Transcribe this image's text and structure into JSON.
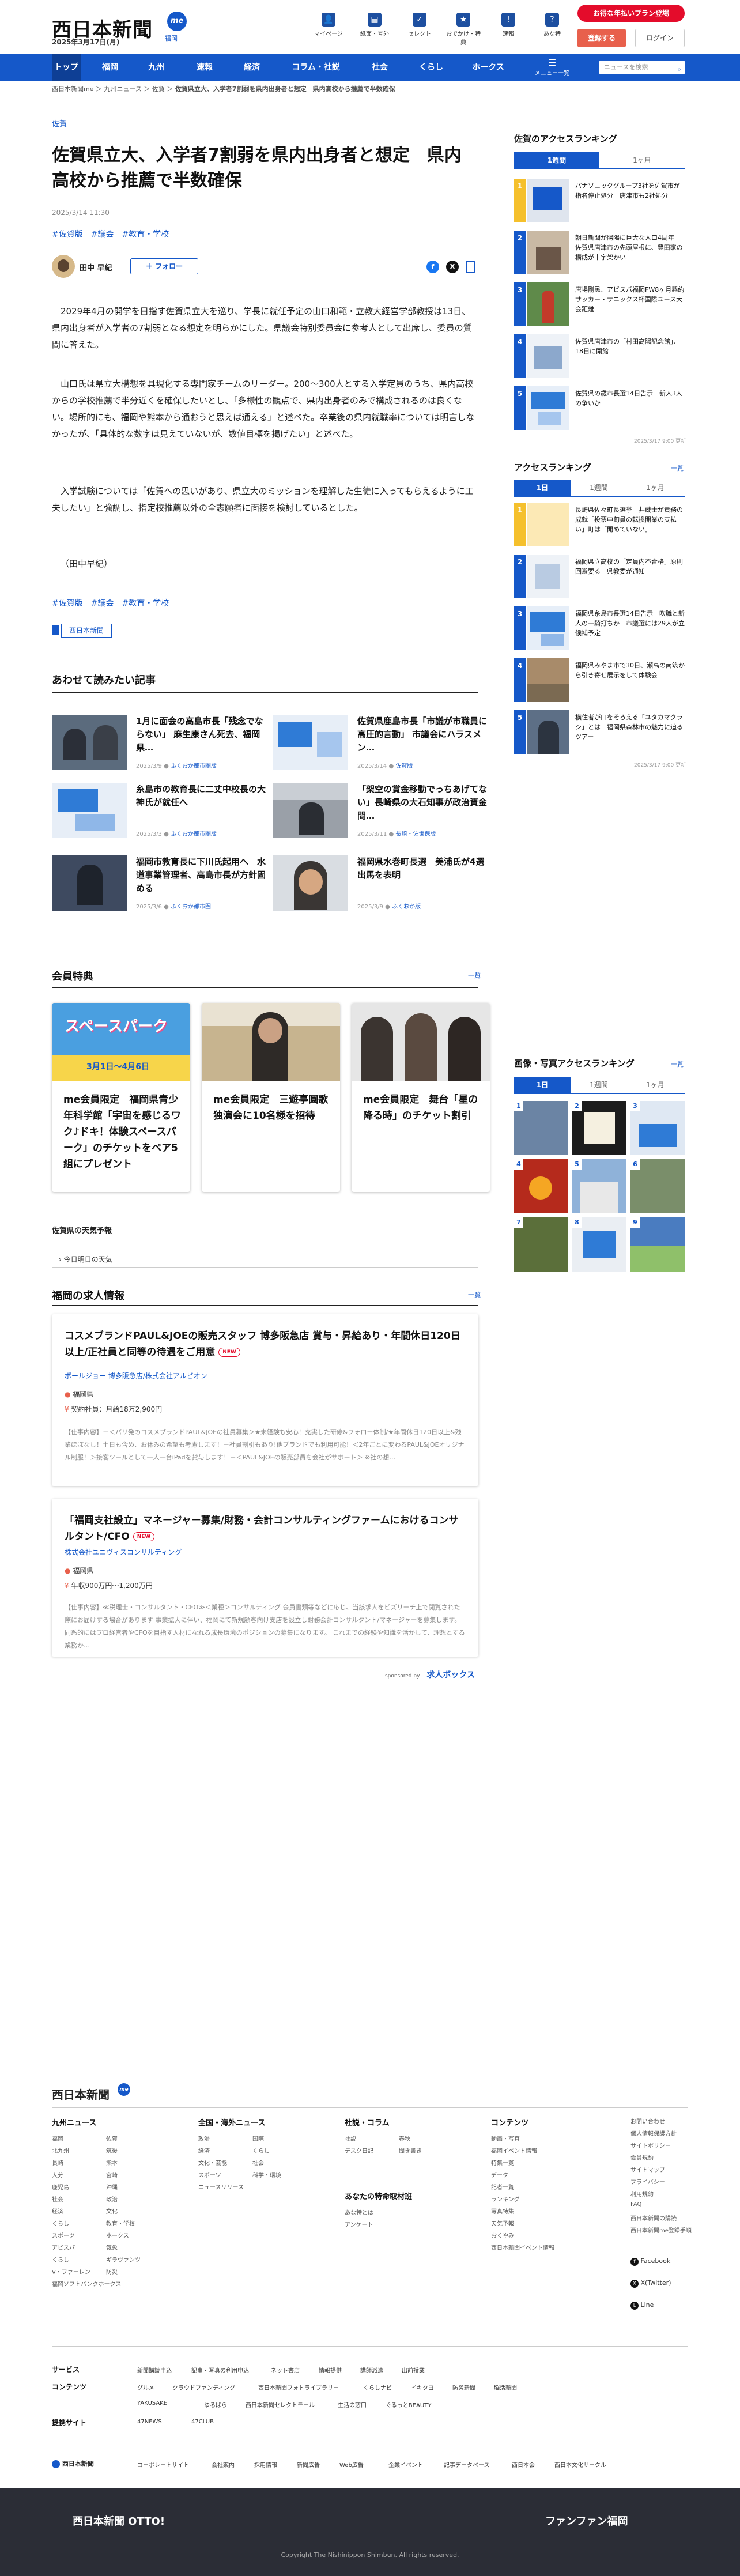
{
  "header": {
    "logo": "西日本新聞",
    "logo_me": "me",
    "logo_sub": "福岡",
    "date": "2025年3月17日(月)",
    "icons": [
      {
        "label": "マイページ",
        "icon": "person-icon",
        "glyph": "👤"
      },
      {
        "label": "紙面・号外",
        "icon": "newspaper-icon",
        "glyph": "▤"
      },
      {
        "label": "セレクト",
        "icon": "select-icon",
        "glyph": "✓"
      },
      {
        "label": "おでかけ・特典",
        "icon": "ticket-icon",
        "glyph": "★"
      },
      {
        "label": "速報",
        "icon": "bell-icon",
        "glyph": "!"
      },
      {
        "label": "あな特",
        "icon": "question-icon",
        "glyph": "?"
      }
    ],
    "plan_button": "お得な年払いプラン登場",
    "register_button": "登録する",
    "login_button": "ログイン"
  },
  "nav": {
    "items": [
      "トップ",
      "福岡",
      "九州",
      "速報",
      "経済",
      "コラム・社説",
      "社会",
      "くらし",
      "ホークス"
    ],
    "menu_label": "メニュー一覧",
    "search_placeholder": "ニュースを検索"
  },
  "breadcrumb": [
    "西日本新聞me",
    "九州ニュース",
    "佐賀",
    "佐賀県立大、入学者7割弱を県内出身者と想定　県内高校から推薦で半数確保"
  ],
  "article": {
    "category": "佐賀",
    "title": "佐賀県立大、入学者7割弱を県内出身者と想定　県内高校から推薦で半数確保",
    "published": "2025/3/14 11:30",
    "tags": [
      "#佐賀版",
      "#議会",
      "#教育・学校"
    ],
    "author": "田中 早紀",
    "follow_label": "＋ フォロー",
    "paragraphs": [
      "2029年4月の開学を目指す佐賀県立大を巡り、学長に就任予定の山口和範・立教大経営学部教授は13日、県内出身者が入学者の7割弱となる想定を明らかにした。県議会特別委員会に参考人として出席し、委員の質問に答えた。",
      "山口氏は県立大構想を具現化する専門家チームのリーダー。200～300人とする入学定員のうち、県内高校からの学校推薦で半分近くを確保したいとし、「多様性の観点で、県内出身者のみで構成されるのは良くない。場所的にも、福岡や熊本から通おうと思えば通える」と述べた。卒業後の県内就職率については明言しなかったが、「具体的な数字は見えていないが、数値目標を掲げたい」と述べた。",
      "入学試験については「佐賀への思いがあり、県立大のミッションを理解した生徒に入ってもらえるように工夫したい」と強調し、指定校推薦以外の全志願者に面接を検討しているとした。",
      "（田中早紀）"
    ],
    "bottom_tags": [
      "#佐賀版",
      "#議会",
      "#教育・学校"
    ],
    "source_badge": "西日本新聞"
  },
  "related": {
    "heading": "あわせて読みたい記事",
    "items": [
      {
        "title": "1月に面会の高島市長「残念でならない」 麻生康さん死去、福岡県…",
        "date": "2025/3/9",
        "src": "ふくおか都市圏版"
      },
      {
        "title": "佐賀県鹿島市長「市議が市職員に高圧的言動」 市議会にハラスメン…",
        "date": "2025/3/14",
        "src": "佐賀版"
      },
      {
        "title": "糸島市の教育長に二丈中校長の大神氏が就任へ",
        "date": "2025/3/3",
        "src": "ふくおか都市圏版"
      },
      {
        "title": "「架空の賞金移動でっちあげてない」長崎県の大石知事が政治資金問…",
        "date": "2025/3/11",
        "src": "長崎・佐世保版"
      },
      {
        "title": "福岡市教育長に下川氏起用へ　水道事業管理者、高島市長が方針固める",
        "date": "2025/3/6",
        "src": "ふくおか都市圏"
      },
      {
        "title": "福岡県水巻町長選　美浦氏が4選出馬を表明",
        "date": "2025/3/9",
        "src": "ふくおか版"
      }
    ]
  },
  "benefits": {
    "heading": "会員特典",
    "more": "一覧",
    "cards": [
      {
        "title": "me会員限定　福岡県青少年科学館「宇宙を感じるワク♪ドキ！体験スペースパーク」のチケットをペア5組にプレゼント",
        "img_text": "スペースパーク",
        "img_date": "3月1日～4月6日"
      },
      {
        "title": "me会員限定　三遊亭圓歌独演会に10名様を招待",
        "img_text": "",
        "img_date": ""
      },
      {
        "title": "me会員限定　舞台「星の降る時」のチケット割引",
        "img_text": "",
        "img_date": ""
      }
    ]
  },
  "weather": {
    "heading": "佐賀県の天気予報",
    "link": "今日明日の天気"
  },
  "jobs": {
    "heading": "福岡の求人情報",
    "more": "一覧",
    "new_label": "NEW",
    "items": [
      {
        "title": "コスメブランドPAUL&JOEの販売スタッフ 博多阪急店 賞与・昇給あり・年間休日120日以上/正社員と同等の待遇をご用意",
        "company": "ポールジョー 博多阪急店/株式会社アルビオン",
        "location": "福岡県",
        "salary": "契約社員：月給18万2,900円",
        "desc": "【仕事内容】－＜パリ発のコスメブランドPAUL&JOEの社員募集＞★未経験も安心！充実した研修&フォロー体制/★年間休日120日以上&残業ほぼなし！土日も含め、お休みの希望も考慮します！－社員割引もあり!他ブランドでも利用可能！＜2年ごとに変わるPAUL&JOEオリジナル制服！＞接客ツールとして一人一台iPadを貸与します！－＜PAUL&JOEの販売部員を会社がサポート＞ ※社の想…"
      },
      {
        "title": "「福岡支社設立」マネージャー募集/財務・会計コンサルティングファームにおけるコンサルタント/CFO",
        "company": "株式会社ユニヴィスコンサルティング",
        "location": "福岡県",
        "salary": "年収900万円～1,200万円",
        "desc": "【仕事内容】≪税理士・コンサルタント・CFO≫＜業種＞コンサルティング 会員書類等などに応じ、当該求人をビズリーチ上で閲覧された際にお届けする場合があります 事業拡大に伴い、福岡にて新規顧客向け支店を設立し財務会計コンサルタント/マネージャーを募集します。同系的にはプロ経営者やCFOを目指す人材になれる成長環境のポジションの募集になります。 これまでの経験や知識を活かして、理想とする業務か…"
      }
    ],
    "sponsor_label": "sponsored by",
    "sponsor_name": "求人ボックス"
  },
  "sidebar": {
    "ranking_saga": {
      "heading": "佐賀のアクセスランキング",
      "tabs": [
        "1週間",
        "1ヶ月"
      ],
      "items": [
        "パナソニックグループ3社を佐賀市が指名停止処分　唐津市も2社処分",
        "朝日新聞が陽陽に巨大な人口4周年　佐賀県唐津市の先頭屋根に、豊田家の構成が十字架かい",
        "唐場剛民、アビスパ福岡FW8ヶ月懸約 サッカー・サニックス杯国際ユース大会距離",
        "佐賀県唐津市の「村田高陽記念館」、18日に開館",
        "佐賀県の歳市長選14日告示　新人3人の争いか"
      ],
      "updated": "2025/3/17 9:00 更新"
    },
    "ranking_all": {
      "heading": "アクセスランキング",
      "more": "一覧",
      "tabs": [
        "1日",
        "1週間",
        "1ヶ月"
      ],
      "items": [
        "長崎県佐々町長選挙　井蔵士が責務の成就「投票中旬員の転換開業の支払い」町は「開めていない」",
        "福岡県立高校の「定員内不合格」原則回避要る　県教委が通知",
        "福岡県糸島市長選14日告示　吹職と新人の一騎打ちか　市議選には29人が立候補予定",
        "福岡県みやま市で30日、瀬高の南筑から引き寄せ展示をして体験会",
        "横住者が口をそろえる「ユタカマクラシ」とは　福岡県森林市の魅力に迫るツアー"
      ],
      "updated": "2025/3/17 9:00 更新"
    },
    "photo_ranking": {
      "heading": "画像・写真アクセスランキング",
      "more": "一覧",
      "tabs": [
        "1日",
        "1週間",
        "1ヶ月"
      ]
    }
  },
  "footer": {
    "logo": "西日本新聞",
    "logo_me": "me",
    "cols": [
      {
        "heading": "九州ニュース",
        "links": [
          "福岡",
          "佐賀",
          "北九州",
          "筑後",
          "長崎",
          "熊本",
          "大分",
          "宮崎",
          "鹿児島",
          "沖縄",
          "社会",
          "政治",
          "経済",
          "文化",
          "くらし",
          "教育・学校",
          "スポーツ",
          "ホークス",
          "アビスパ",
          "気象",
          "くらし",
          "ギラヴァンツ",
          "V・ファーレン",
          "防災",
          "福岡ソフトバンクホークス"
        ]
      },
      {
        "heading": "全国・海外ニュース",
        "links": [
          "政治",
          "国際",
          "経済",
          "くらし",
          "文化・芸能",
          "社会",
          "スポーツ",
          "科学・環境",
          "ニュースリリース"
        ]
      },
      {
        "heading": "社説・コラム",
        "links": [
          "社説",
          "春秋",
          "デスク日記",
          "聞き書き"
        ]
      },
      {
        "heading": "あなたの特命取材班",
        "links": [
          "あな特とは",
          "アンケート"
        ]
      },
      {
        "heading": "コンテンツ",
        "links": [
          "動画・写真",
          "福岡イベント情報",
          "特集一覧",
          "データ",
          "記者一覧",
          "ランキング",
          "写真特集",
          "天気予報",
          "おくやみ",
          "西日本新聞イベント情報"
        ]
      }
    ],
    "side_links": [
      "お問い合わせ",
      "個人情報保護方針",
      "サイトポリシー",
      "会員規約",
      "サイトマップ",
      "プライバシー",
      "利用規約",
      "FAQ",
      "西日本新聞の購読",
      "西日本新聞me登録手順"
    ],
    "social": [
      "Facebook",
      "X(Twitter)",
      "Line"
    ],
    "rows": [
      {
        "heading": "サービス",
        "links": [
          "新聞購読申込",
          "記事・写真の利用申込",
          "ネット書店",
          "情報提供",
          "講師派遣",
          "出前授業"
        ]
      },
      {
        "heading": "コンテンツ",
        "links": [
          "グルメ",
          "クラウドファンディング",
          "西日本新聞フォトライブラリー",
          "くらしナビ",
          "イキタヨ",
          "防災新聞",
          "脳活新聞"
        ]
      },
      {
        "heading": "",
        "links": [
          "YAKUSAKE",
          "ゆるばら",
          "西日本新聞セレクトモール",
          "生活の窓口",
          "ぐるっとBEAUTY"
        ]
      },
      {
        "heading": "提携サイト",
        "links": [
          "47NEWS",
          "47CLUB"
        ]
      }
    ],
    "corp": {
      "logo": "西日本新聞",
      "links": [
        "コーポレートサイト",
        "会社案内",
        "採用情報",
        "新聞広告",
        "Web広告",
        "企業イベント",
        "記事データベース",
        "西日本会",
        "西日本文化サークル"
      ]
    },
    "bar_left": "西日本新聞 OTTO!",
    "bar_right": "ファンファン福岡",
    "copyright": "Copyright The Nishinippon Shimbun. All rights reserved."
  }
}
